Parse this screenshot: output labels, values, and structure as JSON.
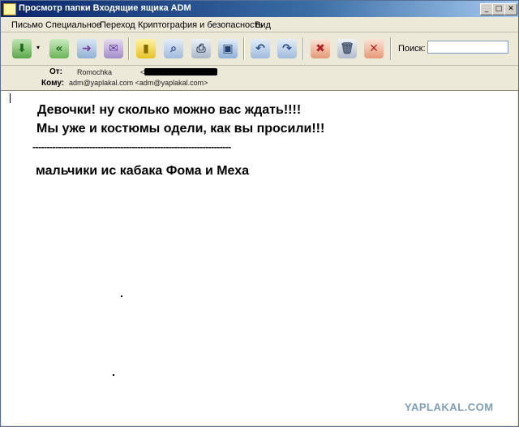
{
  "window": {
    "title": "Просмотр папки Входящие ящика ADM",
    "buttons": {
      "minimize": "_",
      "maximize": "□",
      "close": "✕"
    }
  },
  "menu": [
    {
      "label": "Письмо"
    },
    {
      "label": "Специальное"
    },
    {
      "label": "Переход"
    },
    {
      "label": "Криптография и безопасность"
    },
    {
      "label": "Вид"
    }
  ],
  "toolbar": {
    "icons": [
      "get-mail-icon",
      "dropdown-arrow-icon",
      "reply-all-icon",
      "forward-icon",
      "new-message-icon",
      "address-book-icon",
      "find-icon",
      "print-icon",
      "save-icon",
      "previous-icon",
      "next-icon",
      "mark-spam-icon",
      "delete-icon",
      "junk-icon"
    ],
    "search_label": "Поиск:",
    "search_value": ""
  },
  "headers": {
    "from_label": "От:",
    "from_name": "Romochka",
    "from_email": "<",
    "to_label": "Кому:",
    "to_value": "adm@yaplakal.com <adm@yaplakal.com>"
  },
  "message": {
    "line1": "Девочки! ну сколько можно вас ждать!!!!",
    "line2": "Мы уже и костюмы одели, как вы просили!!!",
    "separator": "----------------------------------------------------------------------",
    "signature": "мальчики ис кабака Фома и Меха"
  },
  "watermark": "YAPLAKAL.COM",
  "colors": {
    "titlebar_start": "#0a246a",
    "titlebar_end": "#a6caf0",
    "chrome": "#ece9d8",
    "watermark": "#7f9fb7"
  }
}
